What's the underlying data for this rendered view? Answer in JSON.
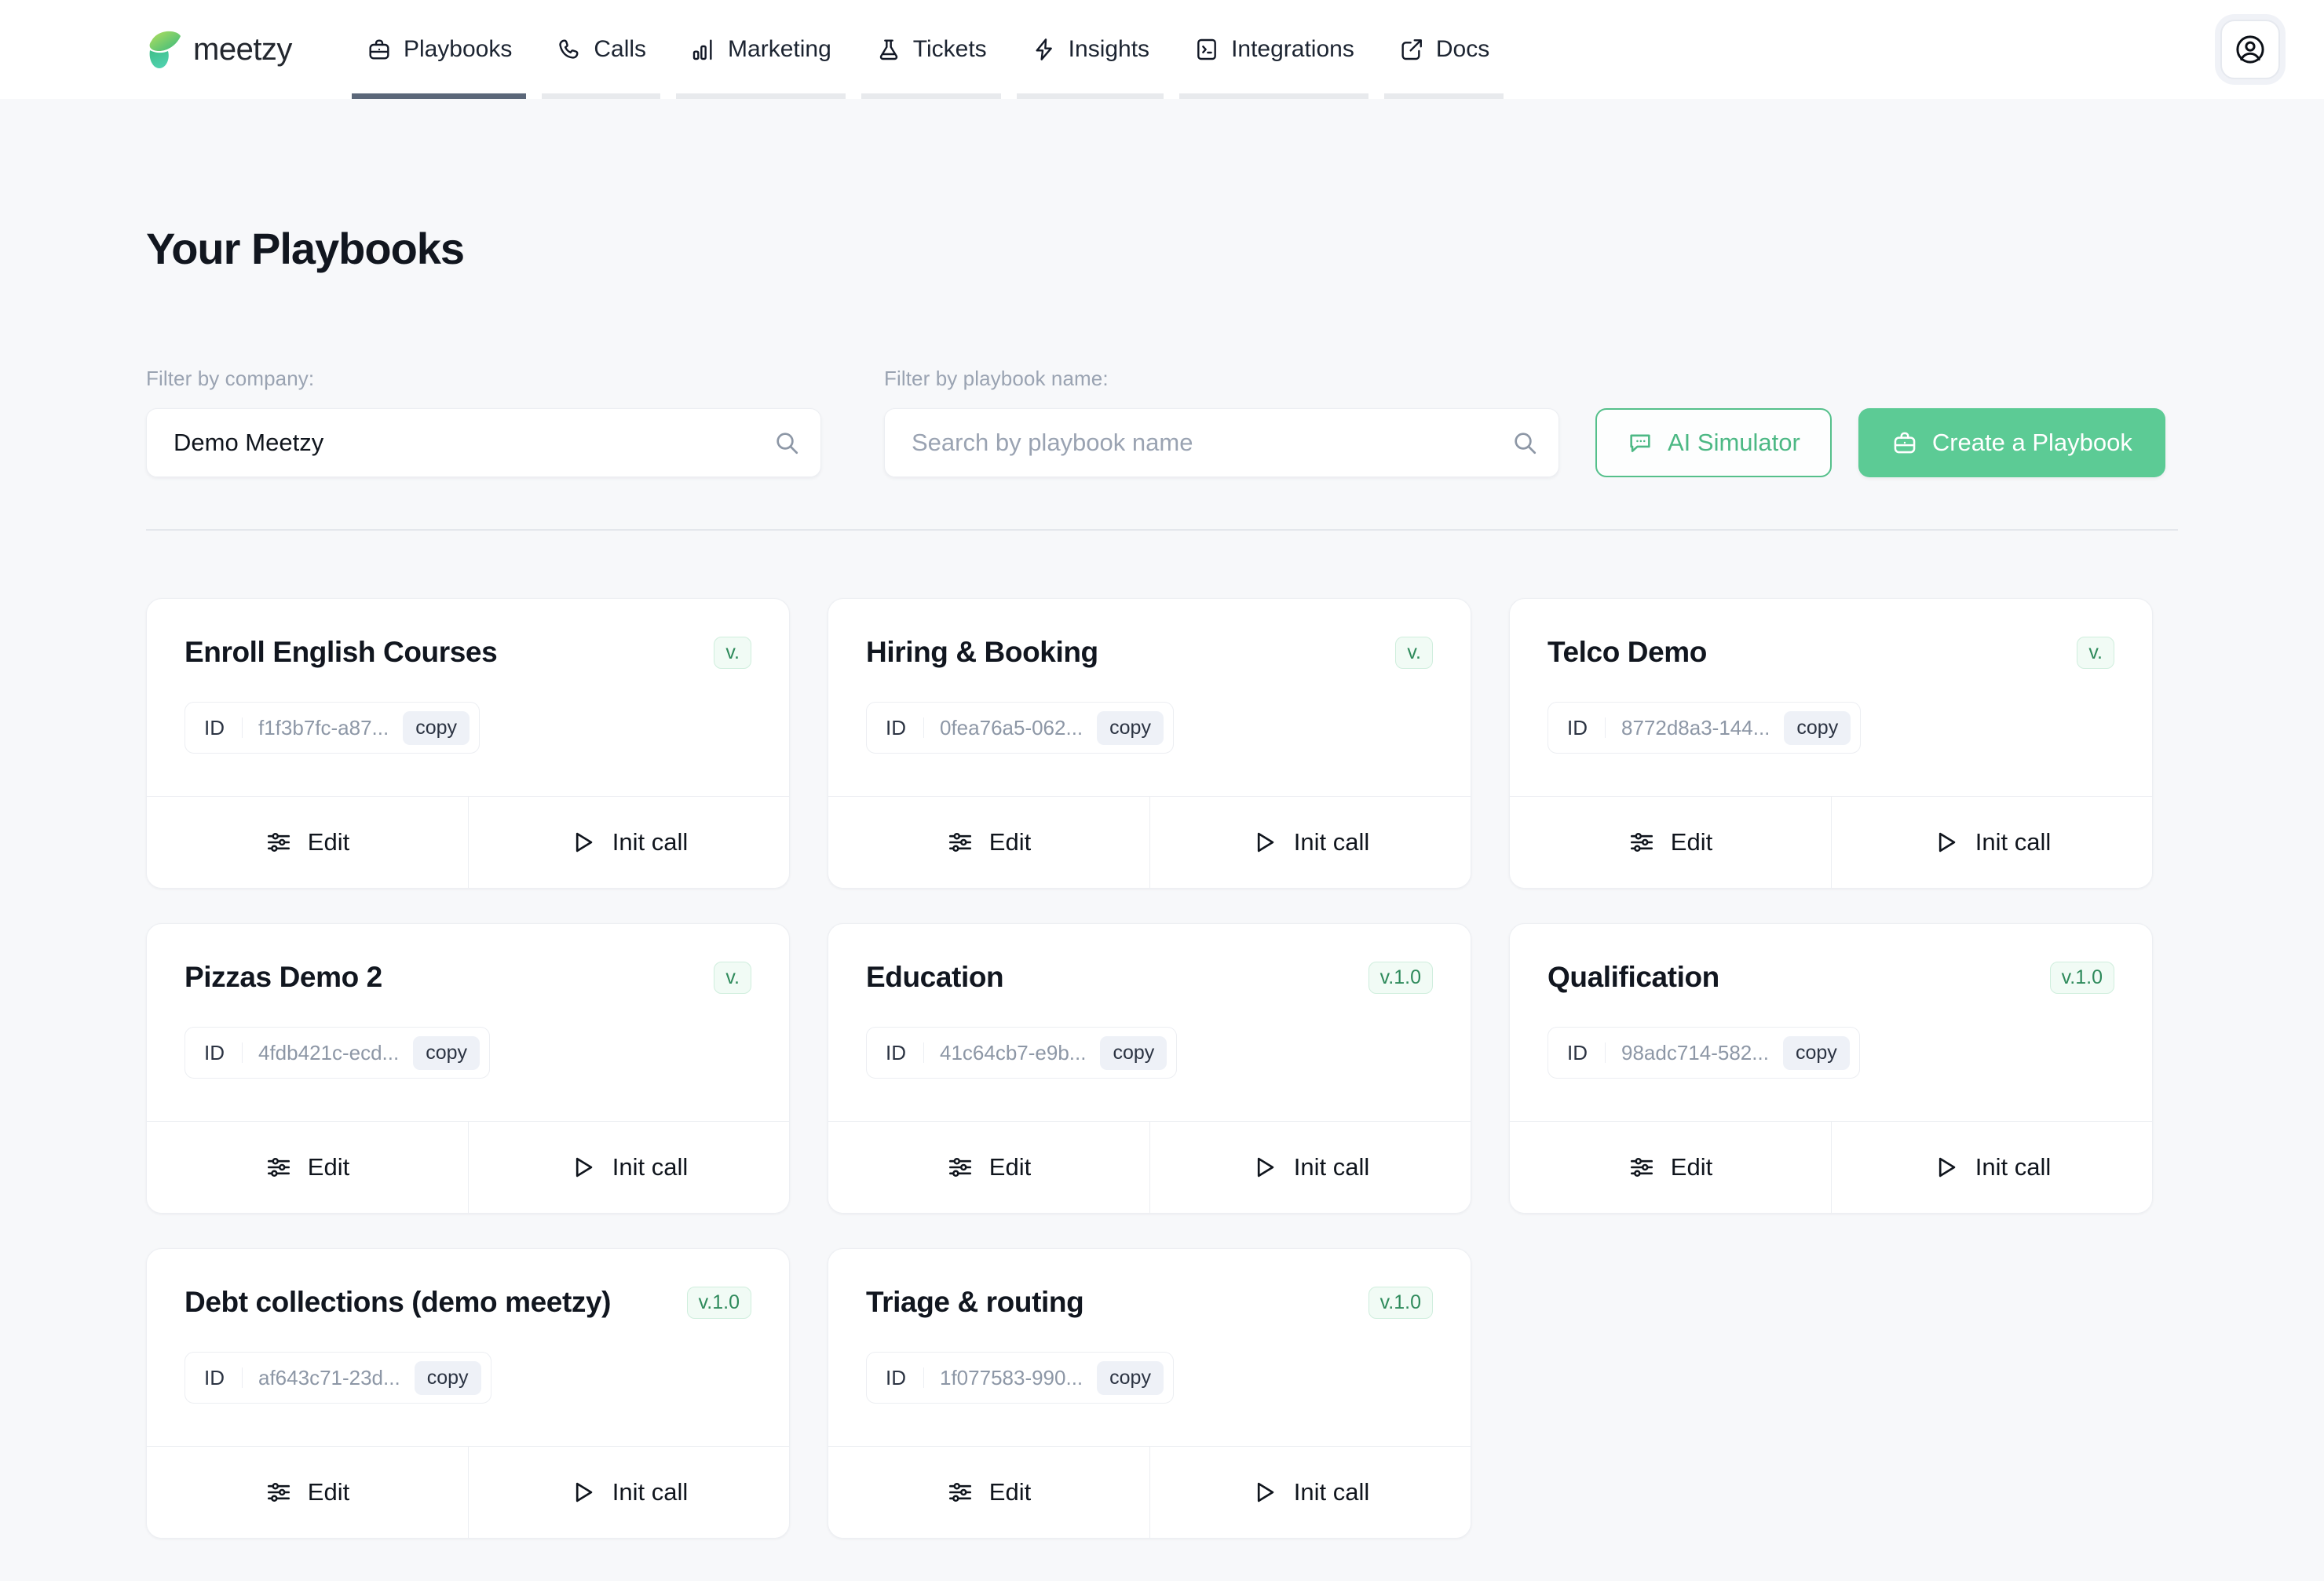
{
  "brand": {
    "name": "meetzy",
    "logo_colors": [
      "#a6d957",
      "#3fbf88",
      "#46c8a0"
    ]
  },
  "nav": {
    "items": [
      {
        "label": "Playbooks",
        "icon": "briefcase-icon",
        "active": true
      },
      {
        "label": "Calls",
        "icon": "phone-icon",
        "active": false
      },
      {
        "label": "Marketing",
        "icon": "bar-chart-icon",
        "active": false
      },
      {
        "label": "Tickets",
        "icon": "flask-icon",
        "active": false
      },
      {
        "label": "Insights",
        "icon": "lightning-icon",
        "active": false
      },
      {
        "label": "Integrations",
        "icon": "terminal-icon",
        "active": false
      },
      {
        "label": "Docs",
        "icon": "external-link-icon",
        "active": false
      }
    ],
    "active_underline_color": "#5b6779",
    "inactive_underline_color": "#e8eaed"
  },
  "header": {
    "title": "Your Playbooks"
  },
  "filters": {
    "company": {
      "label": "Filter by company:",
      "value": "Demo Meetzy",
      "placeholder": "Filter by company"
    },
    "playbook_name": {
      "label": "Filter by playbook name:",
      "value": "",
      "placeholder": "Search by playbook name"
    }
  },
  "actions": {
    "ai_simulator": {
      "label": "AI Simulator",
      "icon": "chat-bubble-icon",
      "color": "#4cb884"
    },
    "create_playbook": {
      "label": "Create a Playbook",
      "icon": "briefcase-icon",
      "bg": "#5ccb95",
      "color": "#ffffff"
    }
  },
  "card_labels": {
    "id": "ID",
    "copy": "copy",
    "edit": "Edit",
    "init_call": "Init call"
  },
  "playbooks": [
    {
      "title": "Enroll English Courses",
      "version": "v.",
      "id": "f1f3b7fc-a87..."
    },
    {
      "title": "Hiring & Booking",
      "version": "v.",
      "id": "0fea76a5-062..."
    },
    {
      "title": "Telco Demo",
      "version": "v.",
      "id": "8772d8a3-144..."
    },
    {
      "title": "Pizzas Demo 2",
      "version": "v.",
      "id": "4fdb421c-ecd..."
    },
    {
      "title": "Education",
      "version": "v.1.0",
      "id": "41c64cb7-e9b..."
    },
    {
      "title": "Qualification",
      "version": "v.1.0",
      "id": "98adc714-582..."
    },
    {
      "title": "Debt collections (demo meetzy)",
      "version": "v.1.0",
      "id": "af643c71-23d..."
    },
    {
      "title": "Triage & routing",
      "version": "v.1.0",
      "id": "1f077583-990..."
    }
  ]
}
